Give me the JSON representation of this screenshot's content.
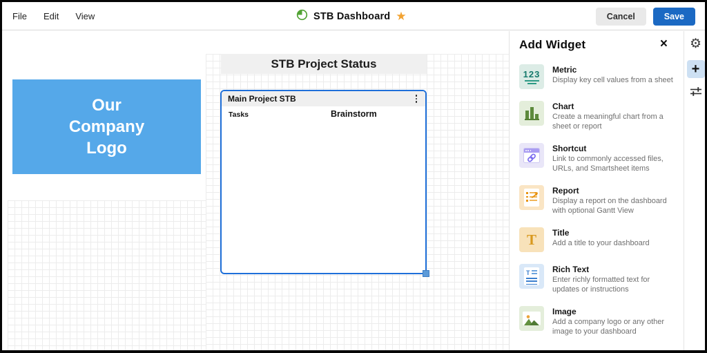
{
  "menubar": {
    "items": [
      "File",
      "Edit",
      "View"
    ]
  },
  "titlebar": {
    "doc_title": "STB Dashboard",
    "cancel_label": "Cancel",
    "save_label": "Save"
  },
  "canvas": {
    "logo_lines": [
      "Our",
      "Company",
      "Logo"
    ],
    "title_widget_text": "STB Project Status",
    "report_widget": {
      "header": "Main Project STB",
      "column_1": "Tasks",
      "column_2": "Brainstorm"
    }
  },
  "panel": {
    "title": "Add Widget",
    "widgets": [
      {
        "name": "Metric",
        "desc": "Display key cell values from a sheet"
      },
      {
        "name": "Chart",
        "desc": "Create a meaningful chart from a sheet or report"
      },
      {
        "name": "Shortcut",
        "desc": "Link to commonly accessed files, URLs, and Smartsheet items"
      },
      {
        "name": "Report",
        "desc": "Display a report on the dashboard with optional Gantt View"
      },
      {
        "name": "Title",
        "desc": "Add a title to your dashboard"
      },
      {
        "name": "Rich Text",
        "desc": "Enter richly formatted text for updates or instructions"
      },
      {
        "name": "Image",
        "desc": "Add a company logo or any other image to your dashboard"
      }
    ]
  },
  "icons": {
    "metric_digits": "123",
    "title_glyph": "T",
    "richtext_glyph": "T",
    "star": "★",
    "close": "×",
    "plus": "+",
    "gear": "⚙"
  },
  "colors": {
    "save_button": "#1b69c3",
    "logo_blue": "#55a8e9",
    "selection_blue": "#1e6fd9",
    "star_orange": "#f2a231",
    "metric_teal": "#15796b",
    "chart_green": "#5d8a3c",
    "shortcut_purple": "#a99cf2",
    "report_orange": "#e8930f",
    "title_amber": "#d8991f",
    "richtext_blue": "#3c80cf",
    "grid_line": "#ececec"
  }
}
